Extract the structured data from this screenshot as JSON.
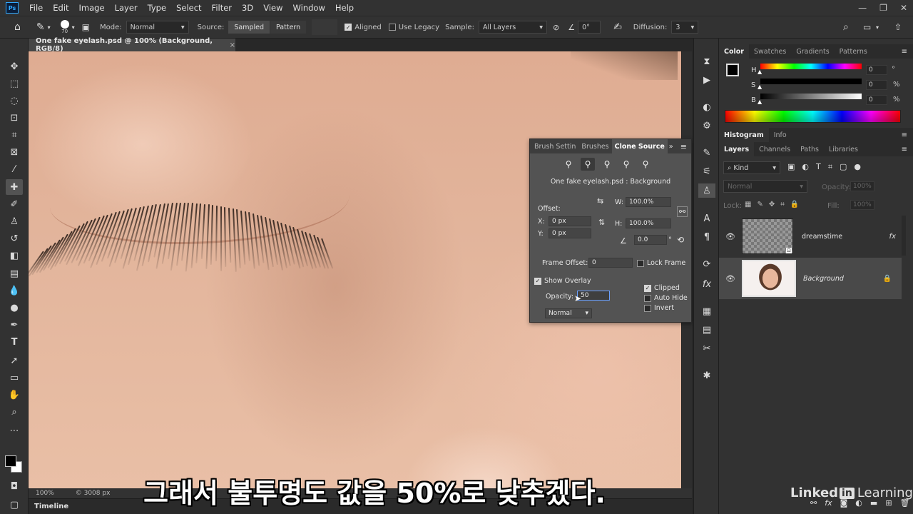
{
  "menu": [
    "File",
    "Edit",
    "Image",
    "Layer",
    "Type",
    "Select",
    "Filter",
    "3D",
    "View",
    "Window",
    "Help"
  ],
  "options_bar": {
    "brush_size": "70",
    "mode_label": "Mode:",
    "mode_value": "Normal",
    "source_label": "Source:",
    "sampled_label": "Sampled",
    "pattern_label": "Pattern",
    "aligned_label": "Aligned",
    "legacy_label": "Use Legacy",
    "sample_label": "Sample:",
    "sample_value": "All Layers",
    "angle_value": "0°",
    "diffusion_label": "Diffusion:",
    "diffusion_value": "3"
  },
  "document": {
    "tab_title": "One fake eyelash.psd @ 100% (Background, RGB/8)",
    "zoom": "100%",
    "doc_info": "© 3008 px"
  },
  "clone_source": {
    "tabs": [
      "Brush Settin",
      "Brushes",
      "Clone Source"
    ],
    "source_name": "One fake eyelash.psd : Background",
    "offset_label": "Offset:",
    "x_label": "X:",
    "x_value": "0 px",
    "y_label": "Y:",
    "y_value": "0 px",
    "w_label": "W:",
    "w_value": "100.0%",
    "h_label": "H:",
    "h_value": "100.0%",
    "angle_value": "0.0",
    "frame_offset_label": "Frame Offset:",
    "frame_offset_value": "0",
    "lock_frame_label": "Lock Frame",
    "show_overlay_label": "Show Overlay",
    "opacity_label": "Opacity:",
    "opacity_value": "50",
    "blend_mode": "Normal",
    "clipped_label": "Clipped",
    "autohide_label": "Auto Hide",
    "invert_label": "Invert"
  },
  "color_panel": {
    "tabs": [
      "Color",
      "Swatches",
      "Gradients",
      "Patterns"
    ],
    "h_label": "H",
    "h_value": "0",
    "s_label": "S",
    "s_value": "0",
    "b_label": "B",
    "b_value": "0",
    "percent": "%"
  },
  "histogram_panel": {
    "tabs": [
      "Histogram",
      "Info"
    ]
  },
  "layers_panel": {
    "tabs": [
      "Layers",
      "Channels",
      "Paths",
      "Libraries"
    ],
    "kind_label": "Kind",
    "blend_mode": "Normal",
    "opacity_label": "Opacity:",
    "opacity_value": "100%",
    "lock_label": "Lock:",
    "fill_label": "Fill:",
    "fill_value": "100%",
    "layers": [
      {
        "name": "dreamstime",
        "fx": "fx"
      },
      {
        "name": "Background"
      }
    ]
  },
  "timeline_label": "Timeline",
  "subtitle": "그래서 불투명도 값을 50%로 낮추겠다.",
  "watermark": {
    "linked": "Linked",
    "in": "in",
    "learning": "Learning"
  }
}
